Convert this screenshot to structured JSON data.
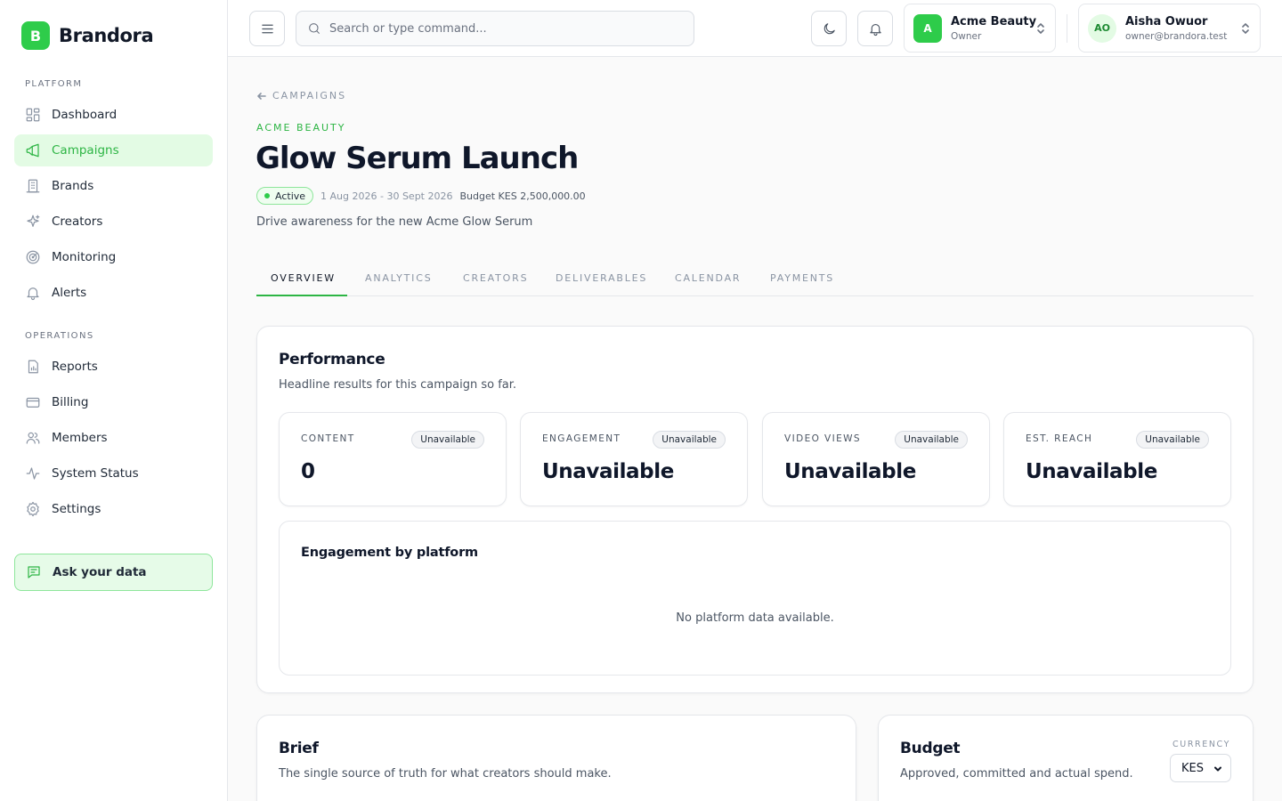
{
  "app": {
    "logo_letter": "B",
    "name": "Brandora"
  },
  "sidebar": {
    "sections": [
      {
        "label": "PLATFORM",
        "items": [
          {
            "label": "Dashboard",
            "icon": "dashboard-icon"
          },
          {
            "label": "Campaigns",
            "icon": "megaphone-icon",
            "active": true
          },
          {
            "label": "Brands",
            "icon": "building-icon"
          },
          {
            "label": "Creators",
            "icon": "sparkles-icon"
          },
          {
            "label": "Monitoring",
            "icon": "radar-icon"
          },
          {
            "label": "Alerts",
            "icon": "bell-icon"
          }
        ]
      },
      {
        "label": "OPERATIONS",
        "items": [
          {
            "label": "Reports",
            "icon": "report-icon"
          },
          {
            "label": "Billing",
            "icon": "credit-card-icon"
          },
          {
            "label": "Members",
            "icon": "users-icon"
          },
          {
            "label": "System Status",
            "icon": "activity-icon"
          },
          {
            "label": "Settings",
            "icon": "gear-icon"
          }
        ]
      }
    ],
    "ask_label": "Ask your data"
  },
  "topbar": {
    "search_placeholder": "Search or type command...",
    "workspace": {
      "avatar": "A",
      "name": "Acme Beauty",
      "role": "Owner"
    },
    "user": {
      "initials": "AO",
      "name": "Aisha Owuor",
      "email": "owner@brandora.test"
    }
  },
  "campaign": {
    "back_label": "CAMPAIGNS",
    "brand": "ACME BEAUTY",
    "title": "Glow Serum Launch",
    "status": "Active",
    "dates": "1 Aug 2026 - 30 Sept 2026",
    "budget": "Budget KES 2,500,000.00",
    "description": "Drive awareness for the new Acme Glow Serum"
  },
  "tabs": [
    {
      "label": "OVERVIEW",
      "active": true
    },
    {
      "label": "ANALYTICS"
    },
    {
      "label": "CREATORS"
    },
    {
      "label": "DELIVERABLES"
    },
    {
      "label": "CALENDAR"
    },
    {
      "label": "PAYMENTS"
    }
  ],
  "performance": {
    "title": "Performance",
    "subtitle": "Headline results for this campaign so far.",
    "stats": [
      {
        "label": "CONTENT",
        "badge": "Unavailable",
        "value": "0"
      },
      {
        "label": "ENGAGEMENT",
        "badge": "Unavailable",
        "value": "Unavailable"
      },
      {
        "label": "VIDEO VIEWS",
        "badge": "Unavailable",
        "value": "Unavailable"
      },
      {
        "label": "EST. REACH",
        "badge": "Unavailable",
        "value": "Unavailable"
      }
    ],
    "platform_title": "Engagement by platform",
    "platform_empty": "No platform data available."
  },
  "brief": {
    "title": "Brief",
    "subtitle": "The single source of truth for what creators should make."
  },
  "budget_card": {
    "title": "Budget",
    "subtitle": "Approved, committed and actual spend.",
    "currency_label": "CURRENCY",
    "currency_value": "KES"
  },
  "colors": {
    "accent": "#2db544",
    "accent_bg": "#e3fbe4",
    "brand": "#2ecc4a"
  }
}
